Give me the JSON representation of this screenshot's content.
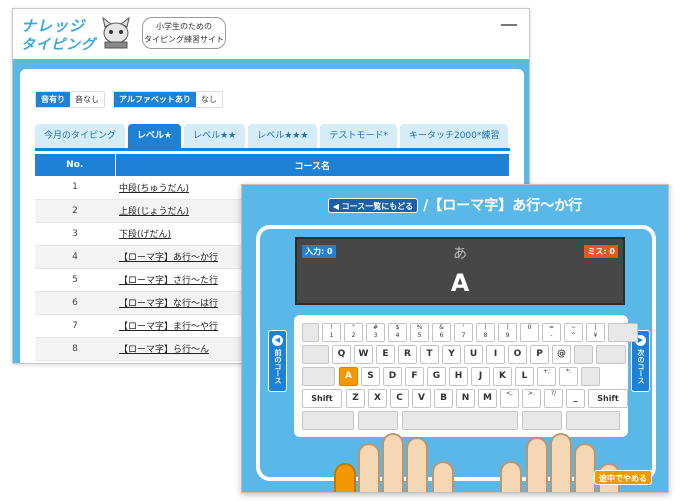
{
  "site": {
    "logo_line1": "ナレッジ",
    "logo_line2": "タイピング",
    "tagline_line1": "小学生のための",
    "tagline_line2": "タイピング練習サイト"
  },
  "settings": {
    "sound_on": "音有り",
    "sound_off": "音なし",
    "alpha_on": "アルファベットあり",
    "alpha_off": "なし"
  },
  "tabs": [
    "今月のタイピング",
    "レベル★",
    "レベル★★",
    "レベル★★★",
    "テストモード*",
    "キータッチ2000*練習"
  ],
  "table": {
    "headers": [
      "No.",
      "コース名"
    ],
    "rows": [
      {
        "no": "1",
        "name": "中段(ちゅうだん)"
      },
      {
        "no": "2",
        "name": "上段(じょうだん)"
      },
      {
        "no": "3",
        "name": "下段(げだん)"
      },
      {
        "no": "4",
        "name": "【ローマ字】あ行〜か行"
      },
      {
        "no": "5",
        "name": "【ローマ字】さ行〜た行"
      },
      {
        "no": "6",
        "name": "【ローマ字】な行〜は行"
      },
      {
        "no": "7",
        "name": "【ローマ字】ま行〜や行"
      },
      {
        "no": "8",
        "name": "【ローマ字】ら行〜ん"
      }
    ]
  },
  "game": {
    "back_label": "コース一覧にもどる",
    "title": "/【ローマ字】あ行〜か行",
    "input_label": "入力: 0",
    "miss_label": "ミス: 0",
    "kana": "あ",
    "romaji": "A",
    "prev_label": "前のコース",
    "next_label": "次のコース",
    "stop_label": "途中でやめる",
    "highlight_color": "#f39800",
    "accent_color": "#1d82d5"
  },
  "keyboard": {
    "num_row": [
      {
        "top": "",
        "bot": ""
      },
      {
        "top": "!",
        "bot": "1"
      },
      {
        "top": "\"",
        "bot": "2"
      },
      {
        "top": "#",
        "bot": "3"
      },
      {
        "top": "$",
        "bot": "4"
      },
      {
        "top": "%",
        "bot": "5"
      },
      {
        "top": "&",
        "bot": "6"
      },
      {
        "top": "'",
        "bot": "7"
      },
      {
        "top": "(",
        "bot": "8"
      },
      {
        "top": ")",
        "bot": "9"
      },
      {
        "top": "",
        "bot": "0"
      },
      {
        "top": "=",
        "bot": "-"
      },
      {
        "top": "~",
        "bot": "^"
      },
      {
        "top": "|",
        "bot": "¥"
      },
      {
        "top": "",
        "bot": ""
      }
    ],
    "q_row": [
      "Q",
      "W",
      "E",
      "R",
      "T",
      "Y",
      "U",
      "I",
      "O",
      "P",
      "@"
    ],
    "a_row": [
      "A",
      "S",
      "D",
      "F",
      "G",
      "H",
      "J",
      "K",
      "L",
      "+;",
      "*:"
    ],
    "z_row": [
      "Z",
      "X",
      "C",
      "V",
      "B",
      "N",
      "M",
      "<,",
      ">.",
      "?/",
      "_"
    ],
    "shift_label": "Shift",
    "highlighted_key": "A"
  }
}
